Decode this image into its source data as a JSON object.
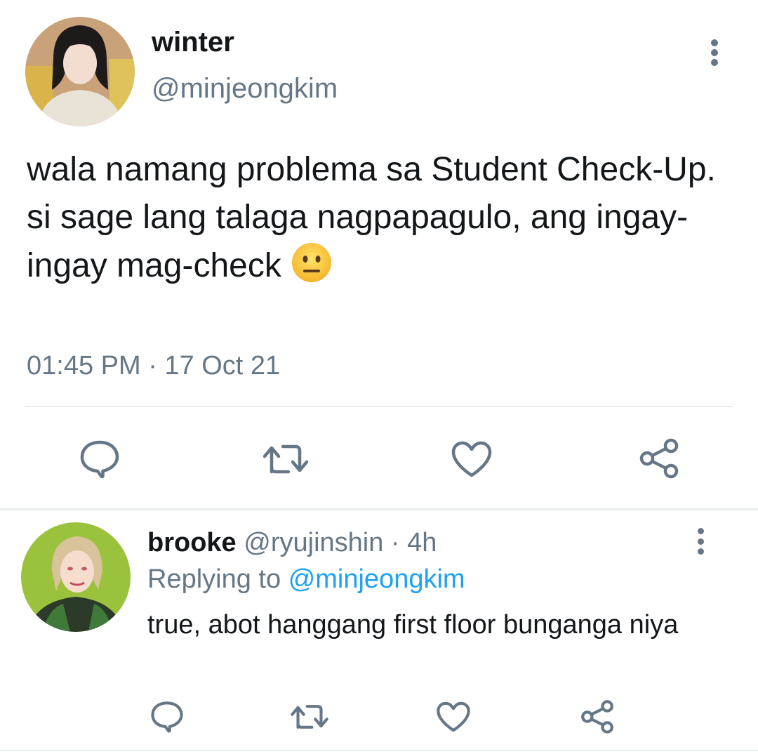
{
  "tweet": {
    "display_name": "winter",
    "handle": "@minjeongkim",
    "text": "wala namang problema sa Student Check-Up. si sage lang talaga nagpapagulo, ang ingay-ingay mag-check",
    "emoji": "neutral-face-emoji",
    "timestamp": "01:45 PM · 17 Oct 21",
    "actions": [
      "reply-icon",
      "retweet-icon",
      "like-icon",
      "share-icon"
    ]
  },
  "reply": {
    "display_name": "brooke",
    "handle": "@ryujinshin",
    "separator": "·",
    "time": "4h",
    "replying_prefix": "Replying to",
    "replying_to": "@minjeongkim",
    "text": "true, abot hanggang first floor bunganga niya",
    "actions": [
      "reply-icon",
      "retweet-icon",
      "like-icon",
      "share-icon"
    ]
  },
  "colors": {
    "text": "#14171a",
    "secondary": "#657786",
    "link": "#1da1f2",
    "divider": "#e6ecf0"
  }
}
